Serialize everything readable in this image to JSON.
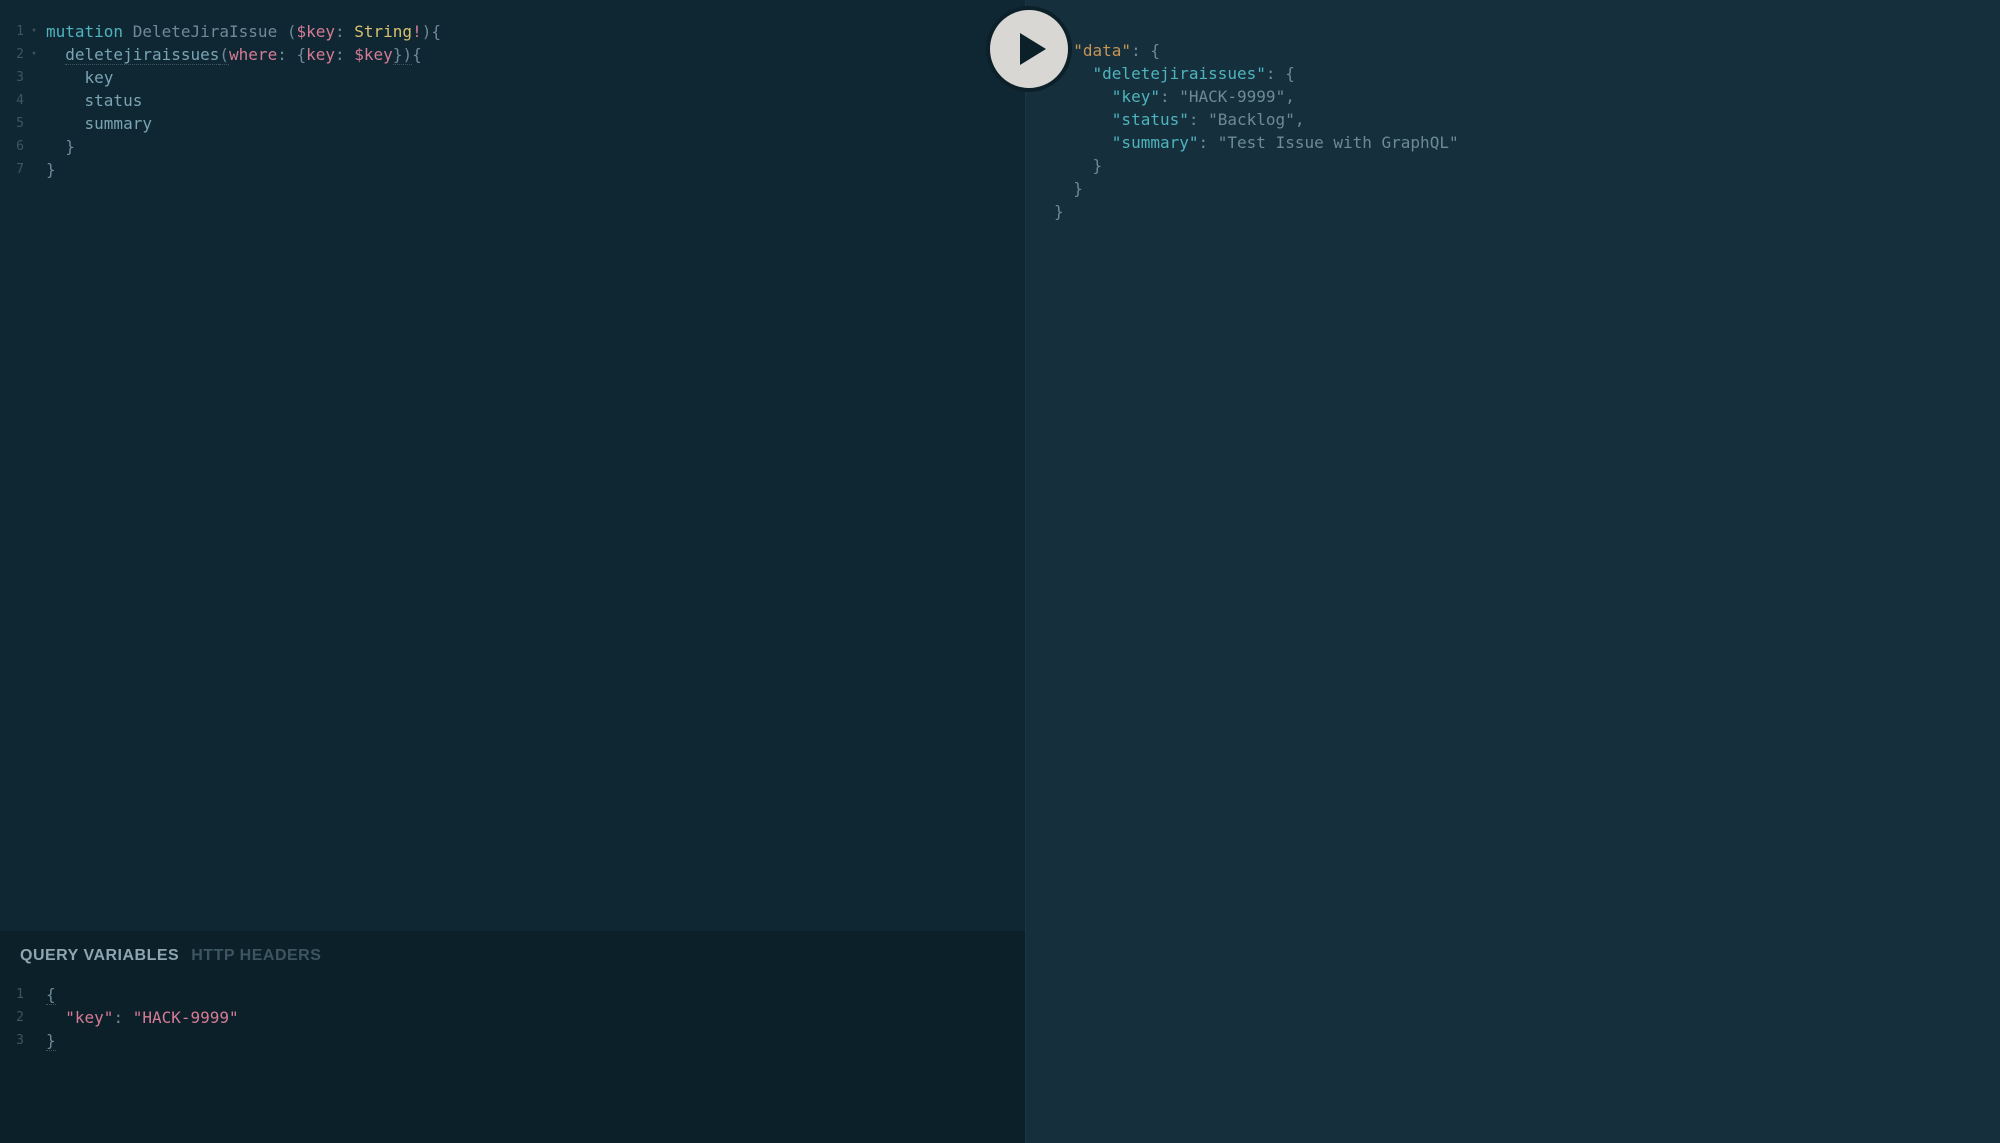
{
  "query": {
    "lines": [
      {
        "num": "1",
        "foldable": true,
        "tokens": [
          {
            "t": "mutation",
            "c": "kw"
          },
          {
            "t": " ",
            "c": ""
          },
          {
            "t": "DeleteJiraIssue",
            "c": "def-name"
          },
          {
            "t": " (",
            "c": "punc"
          },
          {
            "t": "$key",
            "c": "var"
          },
          {
            "t": ": ",
            "c": "punc"
          },
          {
            "t": "String",
            "c": "type"
          },
          {
            "t": "!",
            "c": "bang"
          },
          {
            "t": "){",
            "c": "punc"
          }
        ]
      },
      {
        "num": "2",
        "foldable": true,
        "tokens": [
          {
            "t": "  ",
            "c": ""
          },
          {
            "t": "deletejiraissues",
            "c": "field",
            "dotted": true
          },
          {
            "t": "(",
            "c": "punc",
            "dotted": true
          },
          {
            "t": "where",
            "c": "prop"
          },
          {
            "t": ": {",
            "c": "punc"
          },
          {
            "t": "key",
            "c": "prop"
          },
          {
            "t": ": ",
            "c": "punc"
          },
          {
            "t": "$key",
            "c": "var"
          },
          {
            "t": "})",
            "c": "punc",
            "dotted": true
          },
          {
            "t": "{",
            "c": "punc"
          }
        ]
      },
      {
        "num": "3",
        "foldable": false,
        "tokens": [
          {
            "t": "    ",
            "c": ""
          },
          {
            "t": "key",
            "c": "field"
          }
        ]
      },
      {
        "num": "4",
        "foldable": false,
        "tokens": [
          {
            "t": "    ",
            "c": ""
          },
          {
            "t": "status",
            "c": "field"
          }
        ]
      },
      {
        "num": "5",
        "foldable": false,
        "tokens": [
          {
            "t": "    ",
            "c": ""
          },
          {
            "t": "summary",
            "c": "field"
          }
        ]
      },
      {
        "num": "6",
        "foldable": false,
        "tokens": [
          {
            "t": "  }",
            "c": "punc"
          }
        ]
      },
      {
        "num": "7",
        "foldable": false,
        "tokens": [
          {
            "t": "}",
            "c": "punc"
          }
        ]
      }
    ]
  },
  "tabs": {
    "variables": "QUERY VARIABLES",
    "headers": "HTTP HEADERS"
  },
  "variables": {
    "lines": [
      {
        "num": "1",
        "tokens": [
          {
            "t": "{",
            "c": "brace",
            "dotted": true
          }
        ]
      },
      {
        "num": "2",
        "tokens": [
          {
            "t": "  ",
            "c": ""
          },
          {
            "t": "\"key\"",
            "c": "var"
          },
          {
            "t": ": ",
            "c": "punc"
          },
          {
            "t": "\"HACK-9999\"",
            "c": "var"
          }
        ]
      },
      {
        "num": "3",
        "tokens": [
          {
            "t": "}",
            "c": "brace",
            "dotted": true
          }
        ]
      }
    ]
  },
  "result": {
    "lines": [
      {
        "foldable": true,
        "tokens": [
          {
            "t": "{",
            "c": "brace"
          }
        ]
      },
      {
        "foldable": true,
        "tokens": [
          {
            "t": "  ",
            "c": ""
          },
          {
            "t": "\"data\"",
            "c": "key-orange"
          },
          {
            "t": ": {",
            "c": "brace"
          }
        ]
      },
      {
        "foldable": true,
        "tokens": [
          {
            "t": "    ",
            "c": ""
          },
          {
            "t": "\"deletejiraissues\"",
            "c": "key-teal"
          },
          {
            "t": ": {",
            "c": "brace"
          }
        ]
      },
      {
        "foldable": false,
        "tokens": [
          {
            "t": "      ",
            "c": ""
          },
          {
            "t": "\"key\"",
            "c": "key-teal"
          },
          {
            "t": ": ",
            "c": "colon"
          },
          {
            "t": "\"HACK-9999\"",
            "c": "str"
          },
          {
            "t": ",",
            "c": "brace"
          }
        ]
      },
      {
        "foldable": false,
        "tokens": [
          {
            "t": "      ",
            "c": ""
          },
          {
            "t": "\"status\"",
            "c": "key-teal"
          },
          {
            "t": ": ",
            "c": "colon"
          },
          {
            "t": "\"Backlog\"",
            "c": "str"
          },
          {
            "t": ",",
            "c": "brace"
          }
        ]
      },
      {
        "foldable": false,
        "tokens": [
          {
            "t": "      ",
            "c": ""
          },
          {
            "t": "\"summary\"",
            "c": "key-teal"
          },
          {
            "t": ": ",
            "c": "colon"
          },
          {
            "t": "\"Test Issue with GraphQL\"",
            "c": "str"
          }
        ]
      },
      {
        "foldable": false,
        "tokens": [
          {
            "t": "    }",
            "c": "brace"
          }
        ]
      },
      {
        "foldable": false,
        "tokens": [
          {
            "t": "  }",
            "c": "brace"
          }
        ]
      },
      {
        "foldable": false,
        "tokens": [
          {
            "t": "}",
            "c": "brace"
          }
        ]
      }
    ]
  }
}
